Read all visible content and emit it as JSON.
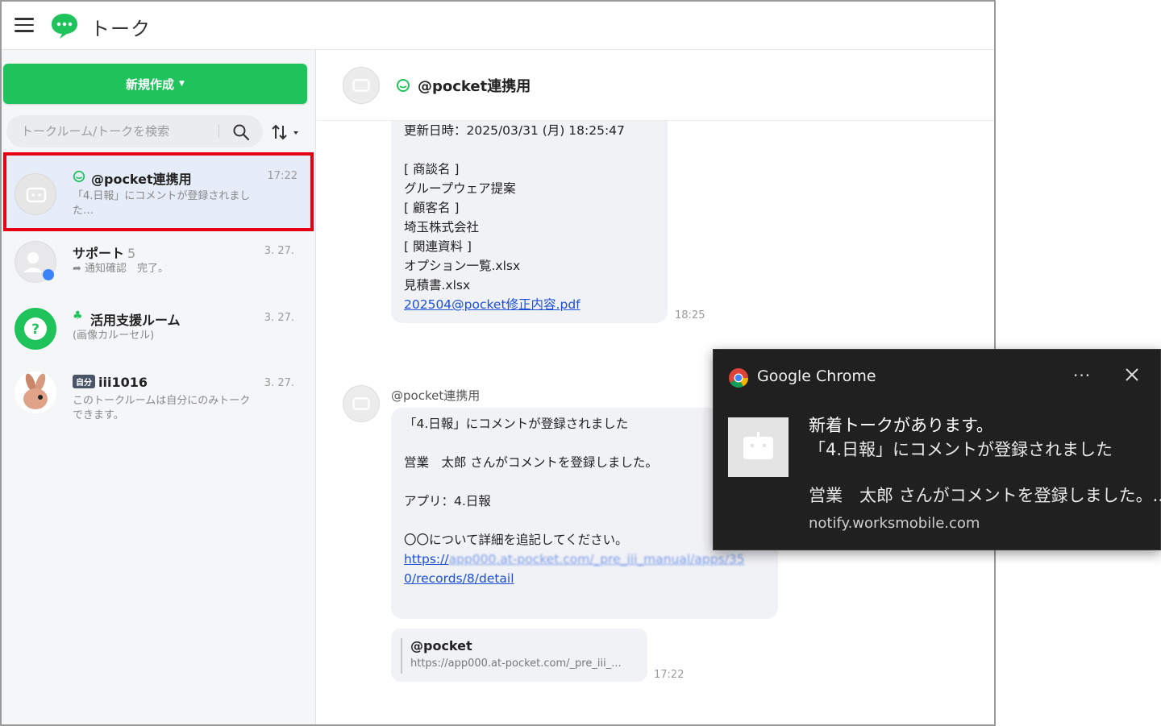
{
  "app": {
    "title": "トーク"
  },
  "sidebar": {
    "new_button": "新規作成",
    "search_placeholder": "トークルーム/トークを検索",
    "chats": [
      {
        "name": "@pocket連携用",
        "time": "17:22",
        "preview": "「4.日報」にコメントが登録されました…",
        "selected": true
      },
      {
        "name": "サポート",
        "count": "5",
        "time": "3. 27.",
        "preview": "通知確認　完了。"
      },
      {
        "name": "活用支援ルーム",
        "time": "3. 27.",
        "preview": "(画像カルーセル)"
      },
      {
        "name": "iii1016",
        "badge": "自分",
        "time": "3. 27.",
        "preview": "このトークルームは自分にのみトークできます。"
      }
    ]
  },
  "chat": {
    "header_name": "@pocket連携用",
    "message1": {
      "lines": "更新日時：2025/03/31 (月) 18:25:47\n\n[ 商談名 ]\nグループウェア提案\n[ 顧客名 ]\n埼玉株式会社\n[ 関連資料 ]\nオプション一覧.xlsx\n見積書.xlsx",
      "link": "202504@pocket修正内容.pdf",
      "time": "18:25"
    },
    "sender": "@pocket連携用",
    "message2": {
      "lines": "「4.日報」にコメントが登録されました\n\n営業　太郎 さんがコメントを登録しました。\n\nアプリ：4.日報\n\n〇〇について詳細を追記してください。\n",
      "link_prefix": "https://",
      "link_blurred": "app000.at-pocket.com/_pre_iii_manual/apps/35",
      "link_suffix": "0/records/8/detail"
    },
    "link_card": {
      "title": "@pocket",
      "url": "https://app000.at-pocket.com/_pre_iii_...",
      "time": "17:22"
    }
  },
  "notification": {
    "app": "Google Chrome",
    "more": "···",
    "title": "新着トークがあります。",
    "line1": "「4.日報」にコメントが登録されました",
    "line2": "営業　太郎 さんがコメントを登録しました。.....",
    "source": "notify.worksmobile.com"
  },
  "colors": {
    "accent": "#1fc35b",
    "highlight": "#e60012",
    "link": "#1a4fd6"
  }
}
